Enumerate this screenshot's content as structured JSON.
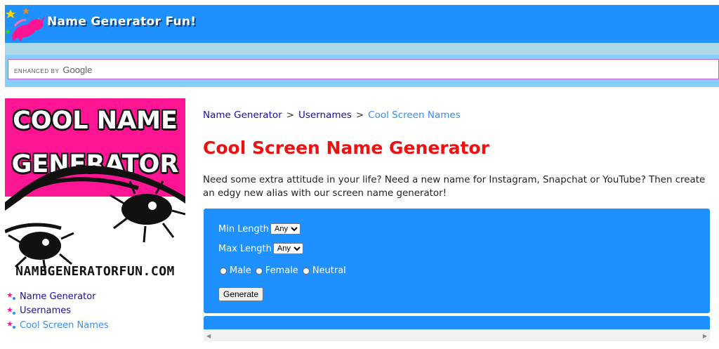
{
  "header": {
    "site_title": "Name Generator Fun!"
  },
  "search": {
    "enhanced_by": "ENHANCED BY",
    "provider": "Google"
  },
  "promo": {
    "title_line1": "COOL NAME",
    "title_line2": "GENERATOR",
    "site": "NAMEGENERATORFUN.COM"
  },
  "sidebar": {
    "items": [
      {
        "label": "Name Generator"
      },
      {
        "label": "Usernames"
      },
      {
        "label": "Cool Screen Names"
      }
    ]
  },
  "breadcrumb": {
    "items": [
      "Name Generator",
      "Usernames",
      "Cool Screen Names"
    ],
    "separator": ">"
  },
  "page": {
    "title": "Cool Screen Name Generator",
    "intro": "Need some extra attitude in your life? Need a new name for Instagram, Snapchat or YouTube? Then create an edgy new alias with our screen name generator!"
  },
  "form": {
    "min_length_label": "Min Length",
    "min_length_value": "Any",
    "max_length_label": "Max Length",
    "max_length_value": "Any",
    "gender_options": [
      "Male",
      "Female",
      "Neutral"
    ],
    "generate_label": "Generate"
  },
  "colors": {
    "brand_blue": "#1e90ff",
    "title_red": "#ee1111",
    "promo_pink": "#ff1493",
    "band_light_blue": "#add8e6"
  },
  "icons": {
    "logo": "unicorn-stars-icon",
    "bullet": "star-bullet-icon"
  }
}
